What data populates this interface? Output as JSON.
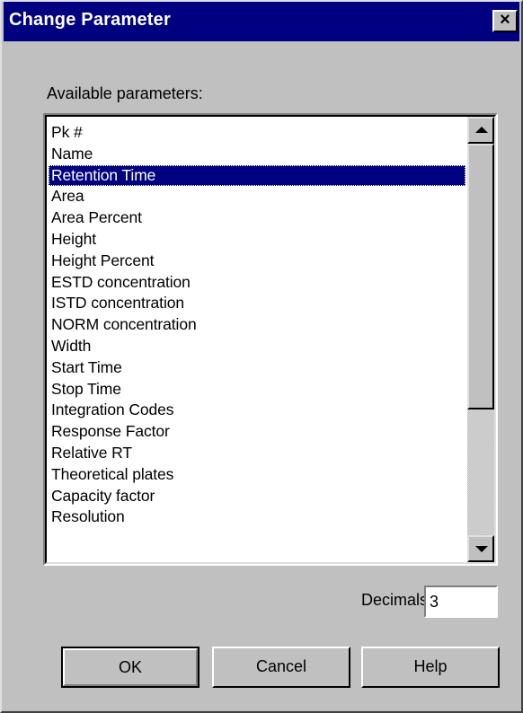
{
  "window": {
    "title": "Change Parameter",
    "close_label": "×"
  },
  "available": {
    "label": "Available parameters:",
    "items": [
      "Pk #",
      "Name",
      "Retention Time",
      "Area",
      "Area Percent",
      "Height",
      "Height Percent",
      "ESTD concentration",
      "ISTD concentration",
      "NORM concentration",
      "Width",
      "Start Time",
      "Stop Time",
      "Integration Codes",
      "Response Factor",
      "Relative RT",
      "Theoretical plates",
      "Capacity factor",
      "Resolution"
    ],
    "selected_item": "Retention Time"
  },
  "decimals": {
    "label": "Decimals:",
    "value": "3"
  },
  "buttons": {
    "ok": "OK",
    "cancel": "Cancel",
    "help": "Help"
  },
  "colors": {
    "titlebar": "#000080",
    "dialog_bg": "#c0c0c0",
    "selection": "#000080"
  },
  "icons": {
    "close": "close-icon",
    "scroll_up": "arrow-up-icon",
    "scroll_down": "arrow-down-icon"
  }
}
